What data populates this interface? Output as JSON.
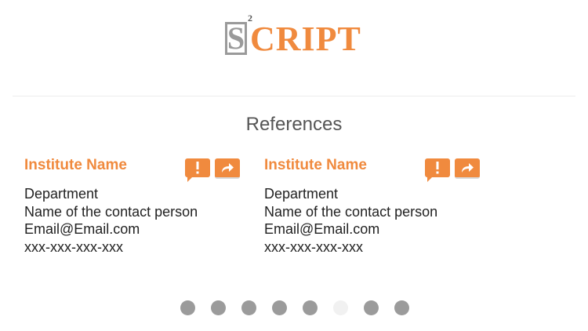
{
  "logo": {
    "letter": "S",
    "superscript": "2",
    "rest": "CRIPT"
  },
  "section": {
    "title": "References"
  },
  "references": [
    {
      "institute": "Institute Name",
      "department": "Department",
      "contact": "Name of the contact person",
      "email": "Email@Email.com",
      "phone": "xxx-xxx-xxx-xxx",
      "report_icon": "exclamation-icon",
      "share_icon": "share-arrow-icon"
    },
    {
      "institute": "Institute Name",
      "department": "Department",
      "contact": "Name of the contact person",
      "email": "Email@Email.com",
      "phone": "xxx-xxx-xxx-xxx",
      "report_icon": "exclamation-icon",
      "share_icon": "share-arrow-icon"
    }
  ],
  "pagination": {
    "count": 8,
    "active_index": 5
  },
  "colors": {
    "accent": "#f08a3e",
    "logo_gray": "#9a9a9a",
    "title": "#555555",
    "text": "#222222",
    "dot": "#9b9b9b",
    "dot_active": "#f1f1f1"
  }
}
